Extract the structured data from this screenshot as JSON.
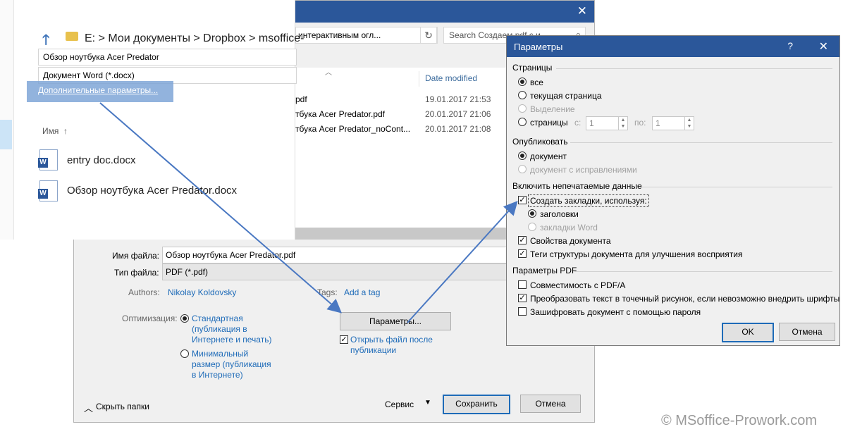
{
  "save_dialog": {
    "close_glyph": "✕",
    "address_text": "интерактивным огл...",
    "search_placeholder": "Search Создаем pdf с и...",
    "columns": {
      "date_modified": "Date modified"
    },
    "files": [
      {
        "name": "pdf",
        "date": "19.01.2017 21:53"
      },
      {
        "name": "тбука Acer Predator.pdf",
        "date": "20.01.2017 21:06"
      },
      {
        "name": "тбука Acer Predator_noCont...",
        "date": "20.01.2017 21:08"
      }
    ],
    "file_name_label": "Имя файла:",
    "file_name_value": "Обзор ноутбука Acer Predator.pdf",
    "file_type_label": "Тип файла:",
    "file_type_value": "PDF (*.pdf)",
    "authors_label": "Authors:",
    "authors_value": "Nikolay Koldovsky",
    "tags_label": "Tags:",
    "tags_value": "Add a tag",
    "optimization_label": "Оптимизация:",
    "opt_standard": [
      "Стандартная",
      "(публикация в",
      "Интернете и печать)"
    ],
    "opt_minimal": [
      "Минимальный",
      "размер (публикация",
      "в Интернете)"
    ],
    "params_button": "Параметры...",
    "open_after": [
      "Открыть файл после",
      "публикации"
    ],
    "hide_folders": "Скрыть папки",
    "service": "Сервис",
    "save_button": "Сохранить",
    "cancel_button": "Отмена"
  },
  "explorer": {
    "path": "E: > Мои документы > Dropbox > msoffice-",
    "title_field": "Обзор ноутбука Acer Predator",
    "type_field": "Документ Word (*.docx)",
    "more_params": "Дополнительные параметры...",
    "name_header": "Имя",
    "name_sort": "↑",
    "docs": [
      "entry doc.docx",
      "Обзор ноутбука Acer Predator.docx"
    ]
  },
  "params_dialog": {
    "title": "Параметры",
    "help": "?",
    "close": "✕",
    "pages_section": "Страницы",
    "pages_all": "все",
    "pages_current": "текущая страница",
    "pages_selection": "Выделение",
    "pages_range": "страницы",
    "from_label": "с:",
    "from_value": "1",
    "to_label": "по:",
    "to_value": "1",
    "publish_section": "Опубликовать",
    "publish_doc": "документ",
    "publish_markup": "документ с исправлениями",
    "nonprint_section": "Включить непечатаемые данные",
    "create_bookmarks": "Создать закладки, используя:",
    "bm_headings": "заголовки",
    "bm_word": "закладки Word",
    "doc_properties": "Свойства документа",
    "struct_tags": "Теги структуры документа для улучшения восприятия",
    "pdf_section": "Параметры PDF",
    "pdfa": "Совместимость с PDF/A",
    "bitmap_text": "Преобразовать текст в точечный рисунок, если невозможно внедрить шрифты",
    "encrypt": "Зашифровать документ с помощью пароля",
    "ok": "OK",
    "cancel": "Отмена"
  },
  "watermark": "© MSoffice-Prowork.com",
  "colors": {
    "title_bar": "#2b579a",
    "link": "#1e6bb8",
    "arrow": "#4a78c2"
  }
}
